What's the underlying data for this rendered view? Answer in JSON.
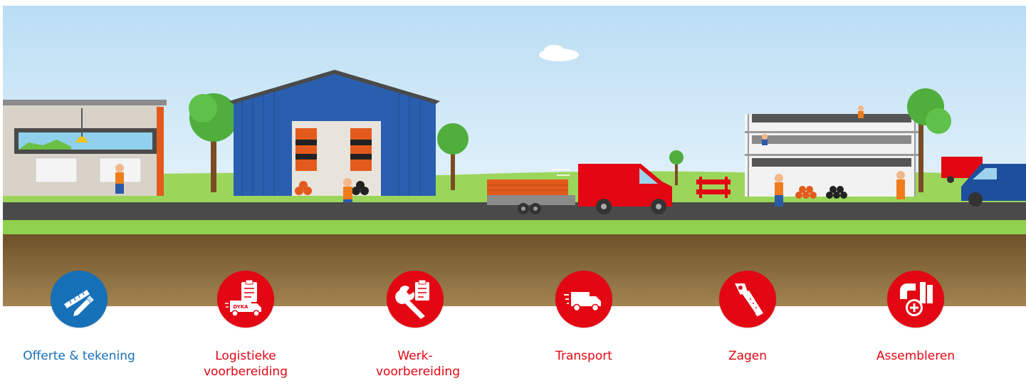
{
  "steps": [
    {
      "id": "offerte",
      "label": "Offerte & tekening",
      "icon": "ruler-pencil-icon",
      "color": "#1670b8",
      "active": true
    },
    {
      "id": "logistiek",
      "label": "Logistieke voorbereiding",
      "icon": "clipboard-truck-icon",
      "color": "#e30613",
      "active": false
    },
    {
      "id": "werk",
      "label": "Werk-voorbereiding",
      "icon": "wrench-clipboard-icon",
      "color": "#e30613",
      "active": false
    },
    {
      "id": "transport",
      "label": "Transport",
      "icon": "truck-icon",
      "color": "#e30613",
      "active": false
    },
    {
      "id": "zagen",
      "label": "Zagen",
      "icon": "saw-icon",
      "color": "#e30613",
      "active": false
    },
    {
      "id": "assembleren",
      "label": "Assembleren",
      "icon": "pipe-fitting-icon",
      "color": "#e30613",
      "active": false
    }
  ],
  "scene": {
    "truck_brand": "DYKA",
    "colors": {
      "sky": "#cfe8f6",
      "grass": "#8fd14f",
      "road": "#4a4a4a",
      "soil": "#8a6a3c",
      "brand_red": "#e30613",
      "brand_blue": "#1670b8"
    }
  }
}
